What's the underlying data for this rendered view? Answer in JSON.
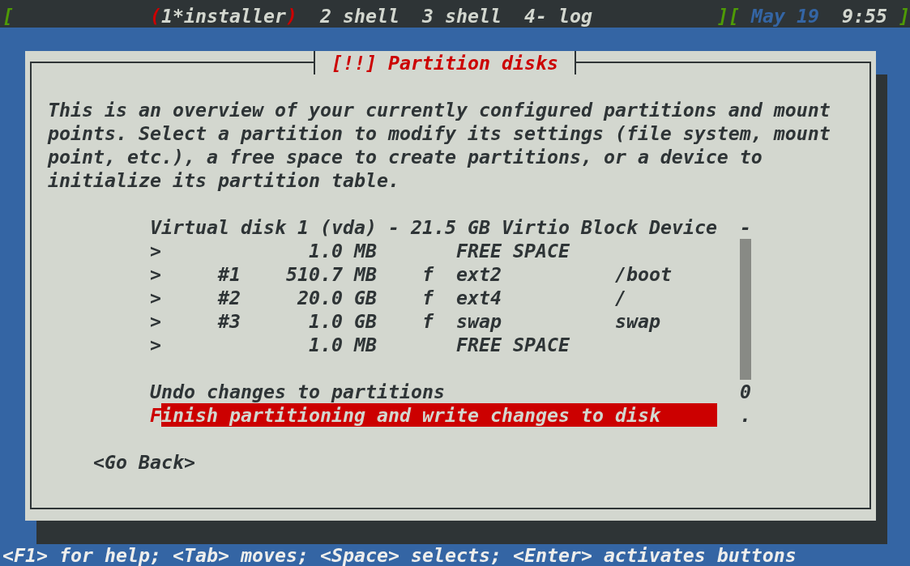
{
  "status_bar": {
    "open": "[",
    "selection_marks": [
      "(",
      ")"
    ],
    "windows": [
      {
        "label": "1*installer",
        "selected": true
      },
      {
        "label": "2 shell",
        "selected": false
      },
      {
        "label": "3 shell",
        "selected": false
      },
      {
        "label": "4- log",
        "selected": false
      }
    ],
    "divider": "][",
    "date": "May 19",
    "time": "9:55",
    "close": "]"
  },
  "dialog": {
    "title": "[!!] Partition disks",
    "description": "This is an overview of your currently configured partitions and mount points. Select a partition to modify its settings (file system, mount point, etc.), a free space to create partitions, or a device to initialize its partition table.",
    "listbox": {
      "rows": [
        {
          "kind": "disk",
          "label": "Virtual disk 1 (vda) - 21.5 GB Virtio Block Device",
          "selected": false
        },
        {
          "kind": "free",
          "marker": ">",
          "size": "1.0 MB",
          "type": "FREE SPACE",
          "selected": false
        },
        {
          "kind": "partition",
          "marker": ">",
          "number": "#1",
          "size": "510.7 MB",
          "flag": "f",
          "type": "ext2",
          "mount": "/boot",
          "selected": false
        },
        {
          "kind": "partition",
          "marker": ">",
          "number": "#2",
          "size": "20.0 GB",
          "flag": "f",
          "type": "ext4",
          "mount": "/",
          "selected": false
        },
        {
          "kind": "partition",
          "marker": ">",
          "number": "#3",
          "size": "1.0 GB",
          "flag": "f",
          "type": "swap",
          "mount": "swap",
          "selected": false
        },
        {
          "kind": "free",
          "marker": ">",
          "size": "1.0 MB",
          "type": "FREE SPACE",
          "selected": false
        }
      ],
      "actions": [
        {
          "label": "Undo changes to partitions",
          "selected": false
        },
        {
          "label": "Finish partitioning and write changes to disk",
          "selected": true
        }
      ],
      "scrollbar": {
        "top_mark": "-",
        "bottom_marks": [
          "0",
          "."
        ]
      }
    },
    "buttons": [
      {
        "label": "<Go Back>"
      }
    ]
  },
  "help_line": "<F1> for help; <Tab> moves; <Space> selects; <Enter> activates buttons"
}
